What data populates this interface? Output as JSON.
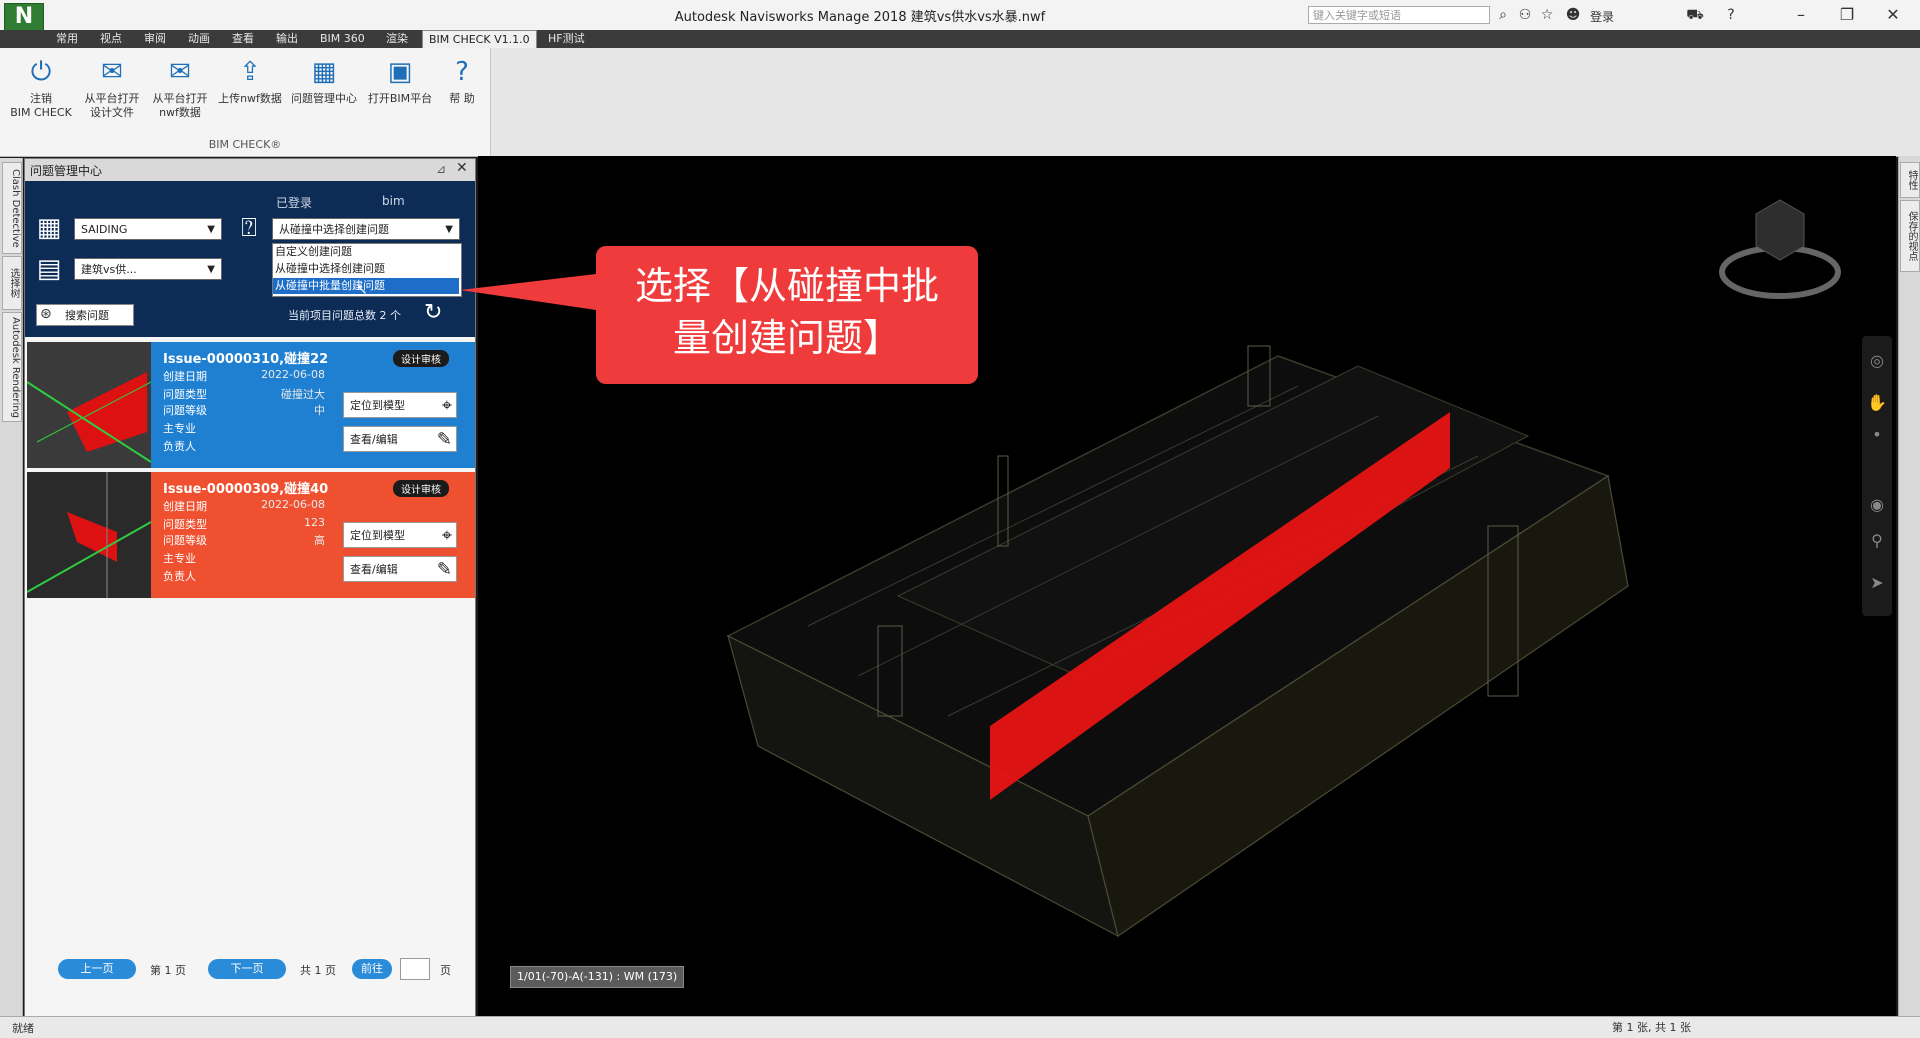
{
  "titlebar": {
    "app_logo": "N",
    "title": "Autodesk Navisworks Manage 2018    建筑vs供水vs水暴.nwf",
    "search_placeholder": "键入关键字或短语",
    "sign_in": "登录",
    "icons": [
      "binoculars-icon",
      "user-group-icon",
      "star-icon",
      "user-icon",
      "cart-icon",
      "help-icon"
    ]
  },
  "menu_tabs": [
    "常用",
    "视点",
    "审阅",
    "动画",
    "查看",
    "输出",
    "BIM 360",
    "渲染",
    "BIM CHECK V1.1.0",
    "HF测试"
  ],
  "active_tab": "BIM CHECK V1.1.0",
  "ribbon": {
    "buttons": [
      {
        "label1": "注销",
        "label2": "BIM CHECK",
        "icon": "power-icon"
      },
      {
        "label1": "从平台打开",
        "label2": "设计文件",
        "icon": "open-design-file-icon"
      },
      {
        "label1": "从平台打开",
        "label2": "nwf数据",
        "icon": "open-nwf-icon"
      },
      {
        "label1": "上传nwf数据",
        "label2": "",
        "icon": "upload-nwf-icon"
      },
      {
        "label1": "问题管理中心",
        "label2": "",
        "icon": "issue-center-icon"
      },
      {
        "label1": "打开BIM平台",
        "label2": "",
        "icon": "open-platform-icon"
      },
      {
        "label1": "帮",
        "label2": "助",
        "icon": "help-icon"
      }
    ],
    "group_label": "BIM CHECK®"
  },
  "left_vtabs": [
    "Clash Detective",
    "选择树",
    "Autodesk Rendering"
  ],
  "panel": {
    "title": "问题管理中心",
    "logged_in_label": "已登录",
    "username": "bim",
    "project_select": "SAIDING",
    "model_select": "建筑vs供...",
    "create_select": "从碰撞中选择创建问题",
    "dropdown_options": [
      "自定义创建问题",
      "从碰撞中选择创建问题",
      "从碰撞中批量创建问题"
    ],
    "dropdown_selected_index": 2,
    "search_button": "搜索问题",
    "issue_total": "当前项目问题总数 2 个"
  },
  "issues": [
    {
      "title": "Issue-00000310,碰撞22",
      "badge": "设计审核",
      "color": "#1f7fd1",
      "labels": [
        "创建日期",
        "问题类型",
        "问题等级",
        "主专业",
        "负责人"
      ],
      "values": [
        "2022-06-08",
        "碰撞过大",
        "中",
        "",
        ""
      ],
      "locate_label": "定位到模型",
      "edit_label": "查看/编辑"
    },
    {
      "title": "Issue-00000309,碰撞40",
      "badge": "设计审核",
      "color": "#ef5030",
      "labels": [
        "创建日期",
        "问题类型",
        "问题等级",
        "主专业",
        "负责人"
      ],
      "values": [
        "2022-06-08",
        "123",
        "高",
        "",
        ""
      ],
      "locate_label": "定位到模型",
      "edit_label": "查看/编辑"
    }
  ],
  "pagination": {
    "prev": "上一页",
    "current": "第 1 页",
    "next": "下一页",
    "total": "共 1 页",
    "go": "前往",
    "page_input": "",
    "page_suffix": "页"
  },
  "viewport": {
    "callout_line1": "选择【从碰撞中批",
    "callout_line2": "量创建问题】",
    "coords": "1/01(-70)-A(-131) : WM (173)"
  },
  "right_vtabs": [
    "特性",
    "保存的视点"
  ],
  "statusbar": {
    "status": "就绪",
    "pages": "第 1 张, 共 1 张"
  },
  "colors": {
    "accent_blue": "#1f7fd1",
    "accent_red": "#ef3b3b",
    "panel_header": "#0d2c55"
  }
}
